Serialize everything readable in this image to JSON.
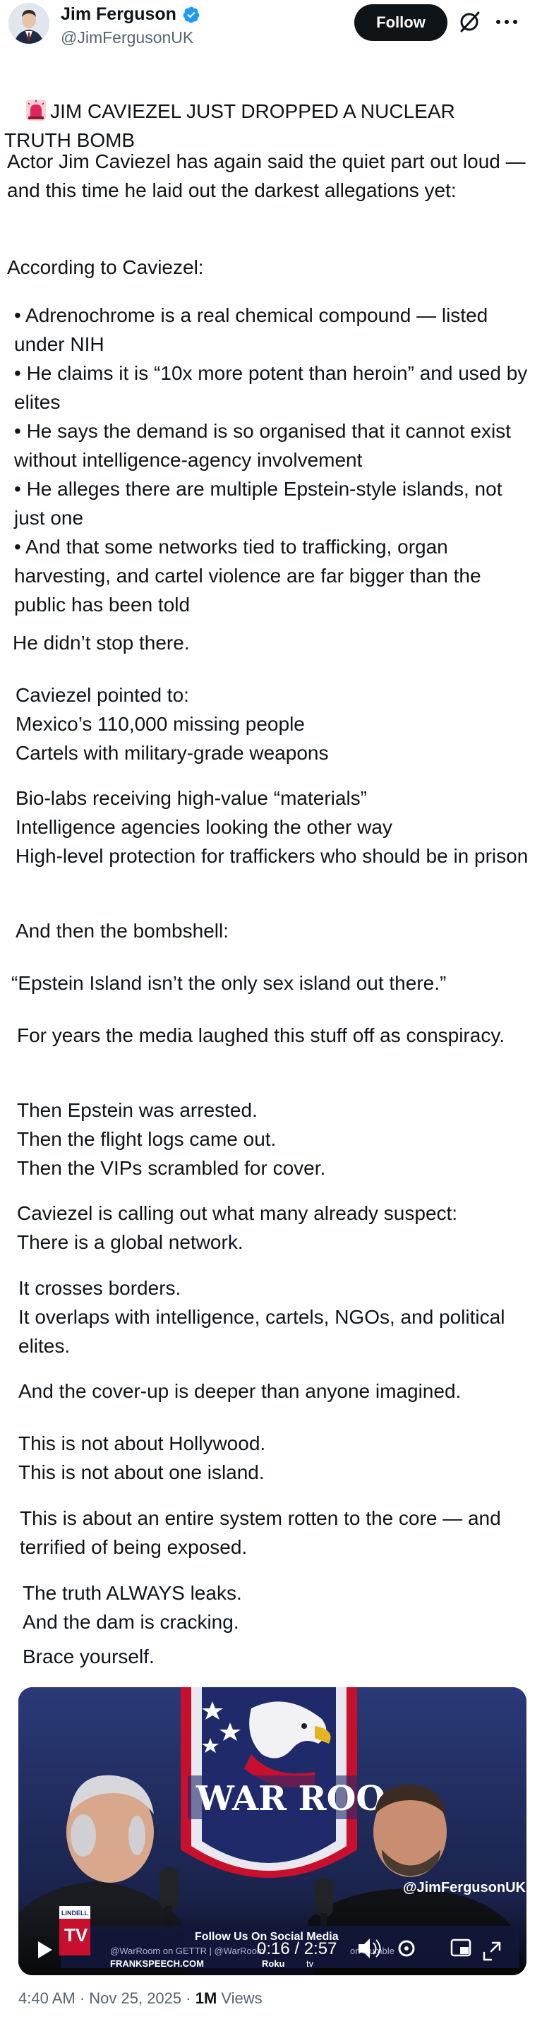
{
  "author": {
    "name": "Jim Ferguson",
    "handle": "@JimFergusonUK",
    "verified_color": "#1d9bf0"
  },
  "header": {
    "follow_label": "Follow"
  },
  "tweet": {
    "headline": "JIM CAVIEZEL JUST DROPPED A NUCLEAR TRUTH BOMB",
    "paragraphs": [
      "Actor Jim Caviezel has again said the quiet part out loud — and this time he laid out the darkest allegations yet:",
      "According to Caviezel:",
      "• Adrenochrome is a real chemical compound — listed under NIH\n• He claims it is “10x more potent than heroin” and used by elites\n• He says the demand is so organised that it cannot exist without intelligence-agency involvement\n• He alleges there are multiple Epstein-style islands, not just one\n• And that some networks tied to trafficking, organ harvesting, and cartel violence are far bigger than the public has been told",
      "He didn’t stop there.",
      "Caviezel pointed to:\nMexico’s 110,000 missing people\nCartels with military-grade weapons",
      "Bio-labs receiving high-value “materials”\nIntelligence agencies looking the other way\nHigh-level protection for traffickers who should be in prison",
      "And then the bombshell:",
      "“Epstein Island isn’t the only sex island out there.”",
      "For years the media laughed this stuff off as conspiracy.",
      "Then Epstein was arrested.\nThen the flight logs came out.\nThen the VIPs scrambled for cover.",
      "Caviezel is calling out what many already suspect:\nThere is a global network.",
      "It crosses borders.\nIt overlaps with intelligence, cartels, NGOs, and political elites.",
      "And the cover-up is deeper than anyone imagined.",
      "This is not about Hollywood.\nThis is not about one island.",
      "This is about an entire system rotten to the core — and terrified of being exposed.",
      "The truth ALWAYS leaks.\nAnd the dam is cracking.",
      "Brace yourself."
    ]
  },
  "video": {
    "banner_text": "WAR ROO",
    "watermark": "@JimFergusonUK",
    "ticker_title": "Follow Us On Social Media",
    "ticker_sub": "@WarRoom on GETTR    |  @WarRoom",
    "ticker_sub2": "on Rumble",
    "ticker_url": "FRANKSPEECH.COM",
    "ticker_roku": "Roku",
    "ticker_tv": "tv",
    "logo_top": "LINDELL",
    "logo_bottom": "TV",
    "time_display": "0:16 / 2:57",
    "accent_red": "#c8102e",
    "accent_blue": "#1f2a6b"
  },
  "meta": {
    "time": "4:40 AM · Nov 25, 2025 · ",
    "views_count": "1M",
    "views_label": " Views"
  }
}
